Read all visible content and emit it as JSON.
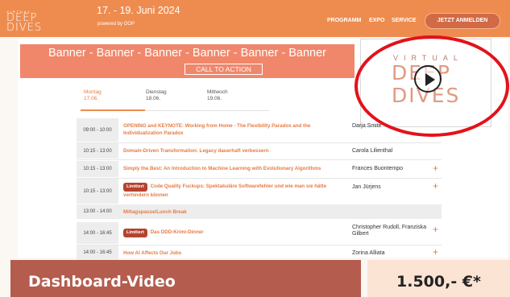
{
  "header": {
    "logo_small": "VIRTUAL",
    "logo_line1": "DEEP",
    "logo_line2": "DIVES",
    "dates": "17. - 19. Juni 2024",
    "powered": "powered by OOP",
    "nav": [
      "PROGRAMM",
      "EXPO",
      "SERVICE"
    ],
    "cta": "JETZT ANMELDEN"
  },
  "banner": {
    "text": "Banner - Banner - Banner - Banner - Banner - Banner",
    "button": "CALL TO ACTION"
  },
  "video_thumb": {
    "line1": "VIRTUAL",
    "line2": "DEEP",
    "line3": "DIVES",
    "icon": "play-icon",
    "highlight_color": "#e3121b"
  },
  "tabs": [
    {
      "day": "Montag",
      "date": "17.06.",
      "active": true
    },
    {
      "day": "Dienstag",
      "date": "18.06.",
      "active": false
    },
    {
      "day": "Mittwoch",
      "date": "19.06.",
      "active": false
    }
  ],
  "schedule": [
    {
      "time": "09:00 - 10:00",
      "title": "OPENING and KEYNOTE: Working from Home - The Flexibility Paradox and the Individualization Paradox",
      "speaker": "Darja Smite",
      "badge": ""
    },
    {
      "time": "10:15 - 13:00",
      "title": "Domain-Driven Transformation: Legacy dauerhaft verbessern",
      "speaker": "Carola Lilienthal",
      "badge": ""
    },
    {
      "time": "10:15 - 13:00",
      "title": "Simply the Best: An Introduction to Machine Learning with Evolutionary Algorithms",
      "speaker": "Frances Buontempo",
      "badge": ""
    },
    {
      "time": "10:15 - 13:00",
      "title": "Code Quality Fuckups: Spektakuläre Softwarefehler und wie man sie hätte verhindern können",
      "speaker": "Jan Jürjens",
      "badge": "Limitiert"
    },
    {
      "time": "13:00 - 14:00",
      "title": "Mittagspause/Lunch Break",
      "speaker": "",
      "badge": ""
    },
    {
      "time": "14:00 - 16:45",
      "title": "Das DDD-Krimi-Dinner",
      "speaker": "Christopher Rudoll, Franziska Gilbert",
      "badge": "Limitiert"
    },
    {
      "time": "14:00 - 16:45",
      "title": "How AI Affects Our Jobs",
      "speaker": "Zorina Alliata",
      "badge": ""
    }
  ],
  "bottom": {
    "label": "Dashboard-Video",
    "price": "1.500,- €*"
  },
  "colors": {
    "accent": "#ee8c4f",
    "banner": "#f0876a",
    "bottom_left": "#b45c4d",
    "bottom_right": "#fbe4d4"
  }
}
